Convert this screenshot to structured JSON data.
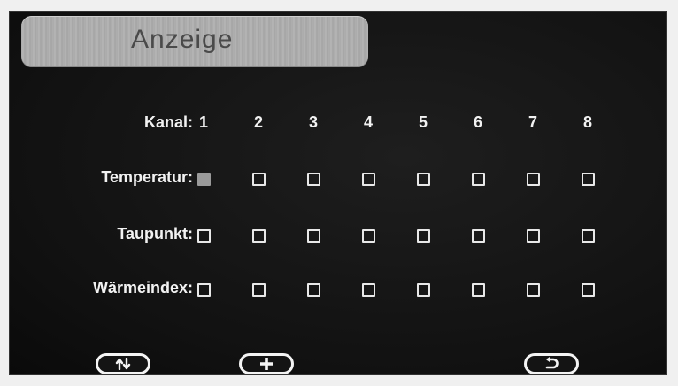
{
  "title": "Anzeige",
  "channel_label": "Kanal:",
  "channels": [
    "1",
    "2",
    "3",
    "4",
    "5",
    "6",
    "7",
    "8"
  ],
  "rows": [
    {
      "label": "Temperatur:",
      "checked": [
        true,
        false,
        false,
        false,
        false,
        false,
        false,
        false
      ]
    },
    {
      "label": "Taupunkt:",
      "checked": [
        false,
        false,
        false,
        false,
        false,
        false,
        false,
        false
      ]
    },
    {
      "label": "Wärmeindex:",
      "checked": [
        false,
        false,
        false,
        false,
        false,
        false,
        false,
        false
      ]
    }
  ],
  "buttons": [
    {
      "icon": "up-down-arrows-icon"
    },
    {
      "icon": "plus-icon"
    },
    {
      "icon": "return-icon"
    }
  ]
}
